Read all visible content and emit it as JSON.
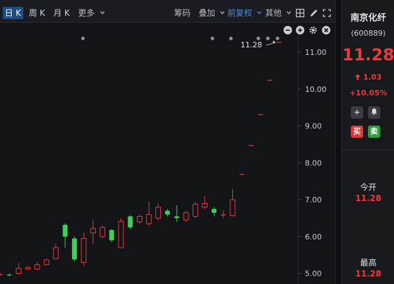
{
  "toolbar": {
    "tabs": [
      {
        "label": "日 K",
        "active": true
      },
      {
        "label": "周 K",
        "active": false
      },
      {
        "label": "月 K",
        "active": false
      }
    ],
    "more_label": "更多",
    "chips_label": "筹码",
    "overlay_label": "叠加",
    "adjust_label": "前复权",
    "other_label": "其他",
    "icons": [
      "chevron-down-icon",
      "grid-layout-icon",
      "draw-pen-icon",
      "fullscreen-icon"
    ]
  },
  "chart_controls": {
    "icons": [
      "zoom-out-icon",
      "zoom-in-icon",
      "settings-icon",
      "close-icon"
    ]
  },
  "stock": {
    "name": "南京化纤",
    "code": "(600889)",
    "price": "11.28",
    "change": "1.03",
    "change_pct": "+10.05%",
    "add_label": "+",
    "alert_label": "alert",
    "buy_label": "买",
    "sell_label": "卖",
    "stats": [
      {
        "label": "今开",
        "value": "11.28"
      },
      {
        "label": "最高",
        "value": "11.28"
      }
    ]
  },
  "colors": {
    "up": "#f0373b",
    "down": "#3fd05a",
    "accent": "#4a8fe2"
  },
  "chart_data": {
    "type": "candlestick",
    "y_ticks": [
      11.0,
      10.0,
      9.0,
      8.0,
      7.0,
      6.0,
      5.0
    ],
    "ylim": [
      4.8,
      11.4
    ],
    "annotation": "11.28",
    "candles": [
      {
        "o": 4.96,
        "c": 4.98,
        "h": 5.02,
        "l": 4.94
      },
      {
        "o": 4.97,
        "c": 4.95,
        "h": 5.0,
        "l": 4.92
      },
      {
        "o": 5.0,
        "c": 5.14,
        "h": 5.28,
        "l": 4.97
      },
      {
        "o": 5.12,
        "c": 5.16,
        "h": 5.2,
        "l": 5.1
      },
      {
        "o": 5.12,
        "c": 5.24,
        "h": 5.32,
        "l": 5.1
      },
      {
        "o": 5.24,
        "c": 5.37,
        "h": 5.4,
        "l": 5.22
      },
      {
        "o": 5.4,
        "c": 5.7,
        "h": 5.8,
        "l": 5.38
      },
      {
        "o": 6.32,
        "c": 6.0,
        "h": 6.36,
        "l": 5.7
      },
      {
        "o": 5.95,
        "c": 5.38,
        "h": 6.0,
        "l": 5.33
      },
      {
        "o": 5.3,
        "c": 5.95,
        "h": 6.1,
        "l": 5.2
      },
      {
        "o": 6.1,
        "c": 6.22,
        "h": 6.45,
        "l": 5.8
      },
      {
        "o": 6.0,
        "c": 6.25,
        "h": 6.3,
        "l": 5.95
      },
      {
        "o": 6.18,
        "c": 5.9,
        "h": 6.2,
        "l": 5.85
      },
      {
        "o": 5.7,
        "c": 6.42,
        "h": 6.5,
        "l": 5.7
      },
      {
        "o": 6.55,
        "c": 6.25,
        "h": 6.58,
        "l": 6.2
      },
      {
        "o": 6.4,
        "c": 6.55,
        "h": 6.6,
        "l": 6.35
      },
      {
        "o": 6.35,
        "c": 6.6,
        "h": 6.95,
        "l": 6.3
      },
      {
        "o": 6.5,
        "c": 6.8,
        "h": 6.9,
        "l": 6.45
      },
      {
        "o": 6.7,
        "c": 6.6,
        "h": 6.75,
        "l": 6.55
      },
      {
        "o": 6.55,
        "c": 6.5,
        "h": 6.85,
        "l": 6.4
      },
      {
        "o": 6.45,
        "c": 6.65,
        "h": 6.7,
        "l": 6.4
      },
      {
        "o": 6.55,
        "c": 6.88,
        "h": 6.95,
        "l": 6.5
      },
      {
        "o": 6.8,
        "c": 6.9,
        "h": 7.1,
        "l": 6.75
      },
      {
        "o": 6.75,
        "c": 6.65,
        "h": 6.8,
        "l": 6.55
      },
      {
        "o": 6.6,
        "c": 6.6,
        "h": 6.7,
        "l": 6.5
      },
      {
        "o": 6.57,
        "c": 7.0,
        "h": 7.28,
        "l": 6.55
      },
      {
        "o": 7.7,
        "c": 7.7,
        "h": 7.7,
        "l": 7.7
      },
      {
        "o": 8.48,
        "c": 8.48,
        "h": 8.48,
        "l": 8.48
      },
      {
        "o": 9.32,
        "c": 9.32,
        "h": 9.32,
        "l": 9.32
      },
      {
        "o": 10.25,
        "c": 10.25,
        "h": 10.25,
        "l": 10.25
      },
      {
        "o": 11.28,
        "c": 11.28,
        "h": 11.28,
        "l": 11.28
      }
    ]
  }
}
